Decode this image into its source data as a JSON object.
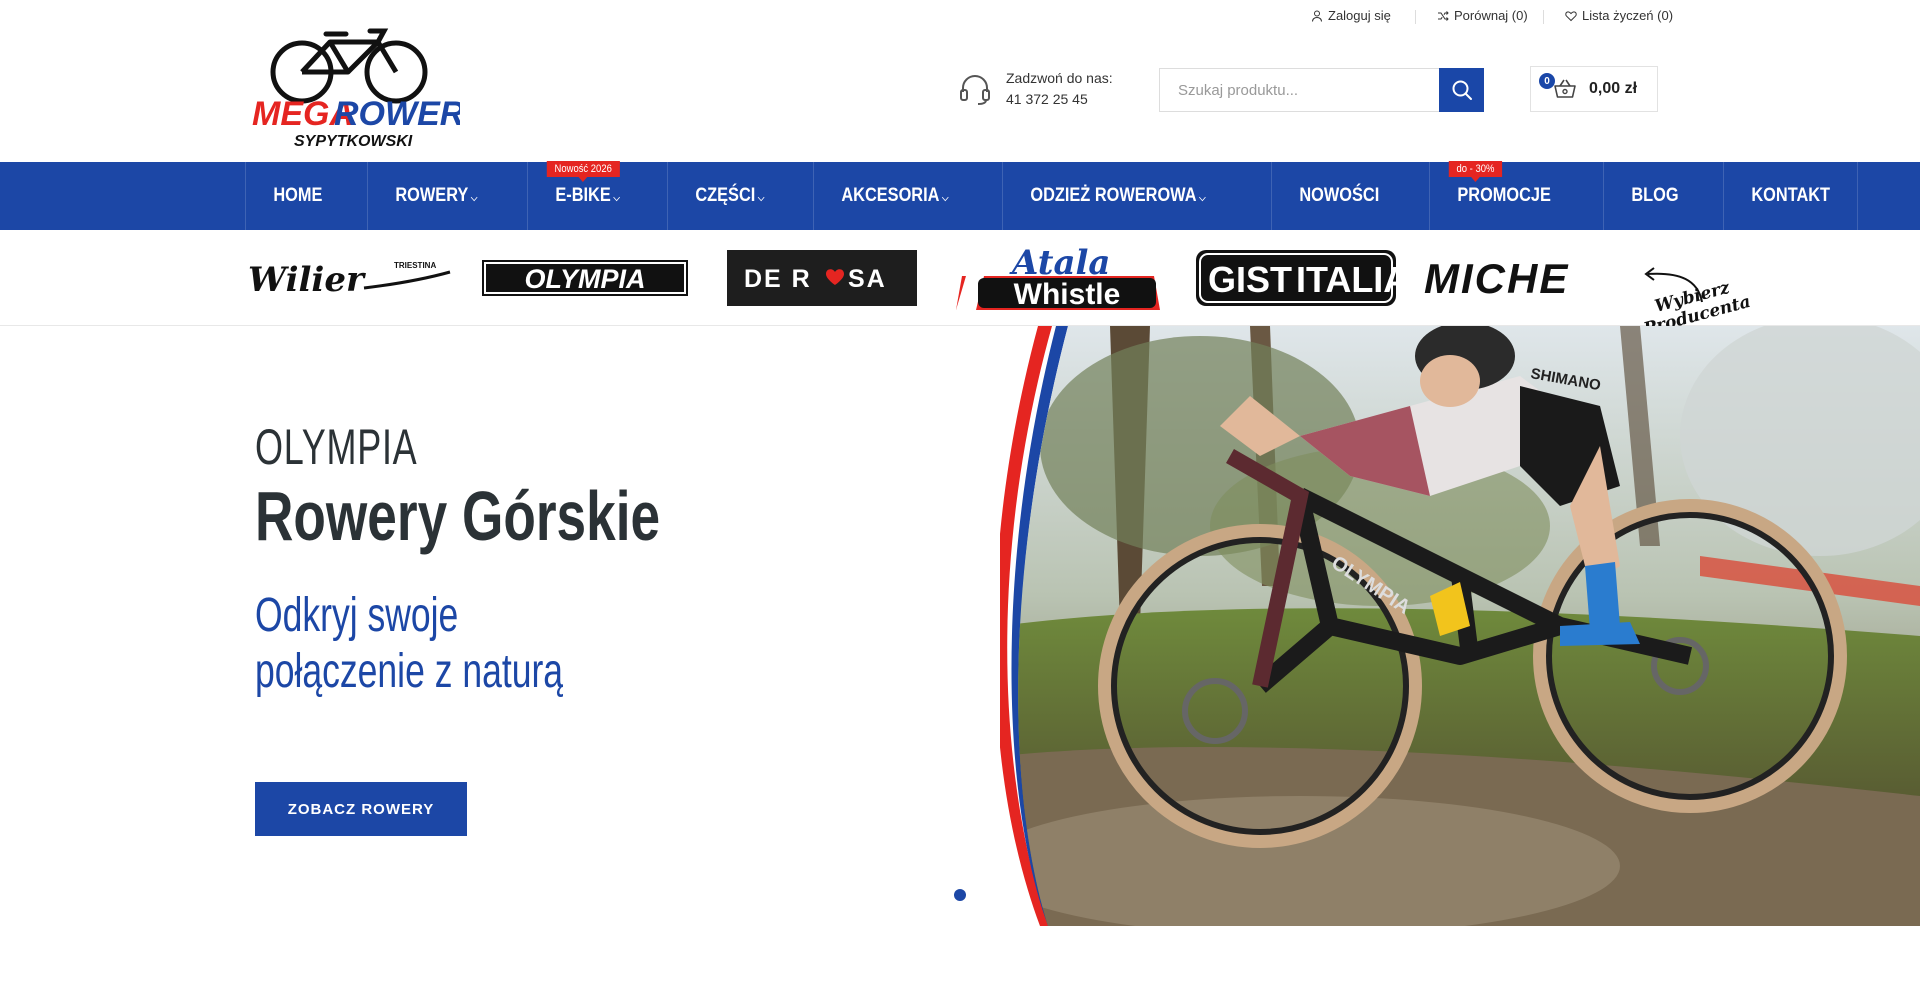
{
  "topbar": {
    "login": "Zaloguj się",
    "compare": "Porównaj (0)",
    "wishlist": "Lista życzeń (0)"
  },
  "header": {
    "logo_line1_a": "MEGA",
    "logo_line1_b": "ROWER",
    "logo_line2": "SYPYTKOWSKI",
    "phone_label": "Zadzwoń do nas:",
    "phone_number": "41 372 25 45",
    "search_placeholder": "Szukaj produktu...",
    "cart_count": "0",
    "cart_total": "0,00 zł"
  },
  "nav": {
    "items": [
      {
        "label": "HOME"
      },
      {
        "label": "ROWERY",
        "caret": "⌵"
      },
      {
        "label": "E-BIKE",
        "caret": "⌵",
        "badge": "Nowość 2026"
      },
      {
        "label": "CZĘŚCI",
        "caret": "⌵"
      },
      {
        "label": "AKCESORIA",
        "caret": "⌵"
      },
      {
        "label": "ODZIEŻ ROWEROWA",
        "caret": "⌵"
      },
      {
        "label": "NOWOŚCI"
      },
      {
        "label": "PROMOCJE",
        "badge": "do - 30%"
      },
      {
        "label": "BLOG"
      },
      {
        "label": "KONTAKT"
      }
    ]
  },
  "brands": {
    "wilier": "Wilier",
    "wilier_sub": "TRIESTINA",
    "olympia": "OLYMPIA",
    "derosa_a": "DE R",
    "derosa_b": "SA",
    "atala": "Atala",
    "whistle": "Whistle",
    "gist_a": "GIST",
    "gist_b": "ITALIA",
    "miche": "MICHE",
    "choose_line1": "Wybierz",
    "choose_line2": "Producenta"
  },
  "hero": {
    "eyebrow": "OLYMPIA",
    "title": "Rowery Górskie",
    "subtitle": "Odkryj swoje\npołączenie z naturą",
    "button": "ZOBACZ ROWERY",
    "jersey_text": "SHIMANO",
    "frame_text": "OLYMPIA"
  },
  "colors": {
    "brand_blue": "#1c47a6",
    "accent_red": "#e52521",
    "title_dark": "#2b3236"
  }
}
